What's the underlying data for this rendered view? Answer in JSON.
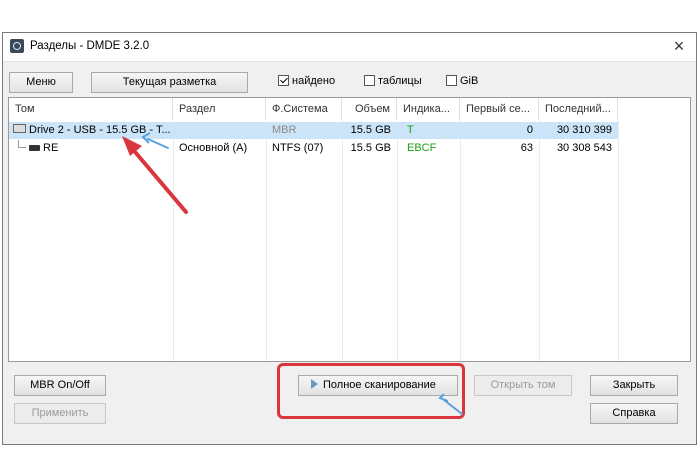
{
  "window": {
    "title": "Разделы - DMDE 3.2.0",
    "close_glyph": "×"
  },
  "toolbar": {
    "menu_label": "Меню",
    "layout_label": "Текущая разметка",
    "checkboxes": [
      {
        "label": "найдено",
        "checked": true
      },
      {
        "label": "таблицы",
        "checked": false
      },
      {
        "label": "GiB",
        "checked": false
      }
    ]
  },
  "table": {
    "columns": [
      "Том",
      "Раздел",
      "Ф.Система",
      "Объем",
      "Индика...",
      "Первый се...",
      "Последний..."
    ],
    "rows": [
      {
        "volume": "Drive 2 - USB - 15.5 GB - T...",
        "partition": "",
        "fs": "MBR",
        "size": "15.5 GB",
        "indicator": "T",
        "first": "0",
        "last": "30 310 399",
        "selected": true
      },
      {
        "volume": "RE",
        "partition": "Основной (A)",
        "fs": "NTFS (07)",
        "size": "15.5 GB",
        "indicator": "EBCF",
        "first": "63",
        "last": "30 308 543",
        "selected": false
      }
    ]
  },
  "footer": {
    "mbr_label": "MBR On/Off",
    "apply_label": "Применить",
    "full_scan_label": "Полное сканирование",
    "open_volume_label": "Открыть том",
    "close_label": "Закрыть",
    "help_label": "Справка"
  },
  "colors": {
    "accent_red": "#d9363e",
    "arrow_blue": "#5aa0e0",
    "selection": "#cce4f7",
    "indicator_green": "#1aa01a"
  },
  "icons": {
    "app": "dmde-app-icon",
    "drive": "usb-drive-icon",
    "volume": "volume-icon",
    "scan": "play-icon"
  }
}
